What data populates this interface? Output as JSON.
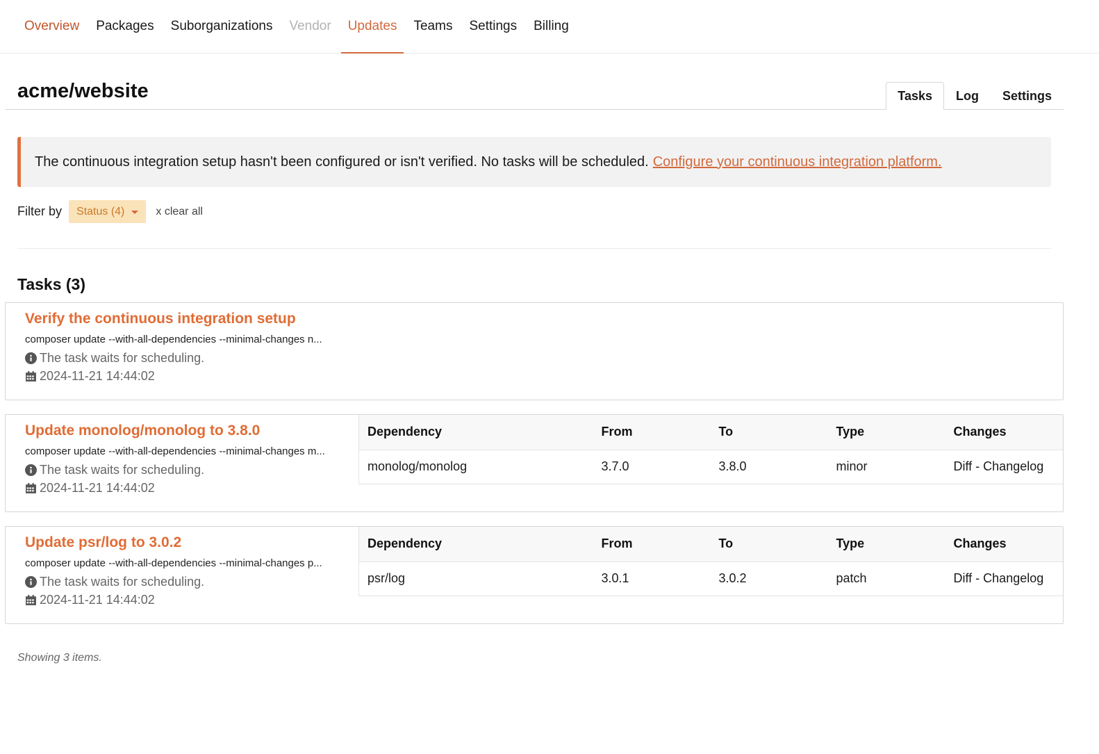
{
  "nav": {
    "items": [
      {
        "label": "Overview"
      },
      {
        "label": "Packages"
      },
      {
        "label": "Suborganizations"
      },
      {
        "label": "Vendor"
      },
      {
        "label": "Updates"
      },
      {
        "label": "Teams"
      },
      {
        "label": "Settings"
      },
      {
        "label": "Billing"
      }
    ],
    "active": "Updates"
  },
  "header": {
    "title": "acme/website",
    "tabs": [
      {
        "label": "Tasks"
      },
      {
        "label": "Log"
      },
      {
        "label": "Settings"
      }
    ],
    "active_tab": "Tasks"
  },
  "alert": {
    "text": "The continuous integration setup hasn't been configured or isn't verified. No tasks will be scheduled.",
    "link": "Configure your continuous integration platform."
  },
  "filter": {
    "label": "Filter by",
    "status_button": "Status (4)",
    "clear_all": "x clear all"
  },
  "tasks_heading": "Tasks (3)",
  "table_headers": {
    "dependency": "Dependency",
    "from": "From",
    "to": "To",
    "type": "Type",
    "changes": "Changes"
  },
  "tasks": [
    {
      "title": "Verify the continuous integration setup",
      "command": "composer update --with-all-dependencies --minimal-changes n...",
      "status": "The task waits for scheduling.",
      "date": "2024-11-21 14:44:02"
    },
    {
      "title": "Update monolog/monolog to 3.8.0",
      "command": "composer update --with-all-dependencies --minimal-changes m...",
      "status": "The task waits for scheduling.",
      "date": "2024-11-21 14:44:02",
      "dependency": {
        "name": "monolog/monolog",
        "from": "3.7.0",
        "to": "3.8.0",
        "type": "minor",
        "changes": "Diff - Changelog"
      }
    },
    {
      "title": "Update psr/log to 3.0.2",
      "command": "composer update --with-all-dependencies --minimal-changes p...",
      "status": "The task waits for scheduling.",
      "date": "2024-11-21 14:44:02",
      "dependency": {
        "name": "psr/log",
        "from": "3.0.1",
        "to": "3.0.2",
        "type": "patch",
        "changes": "Diff - Changelog"
      }
    }
  ],
  "footer": {
    "showing": "Showing 3 items."
  },
  "colors": {
    "accent": "#d2693d",
    "alert_border": "#e2703f",
    "filter_bg": "#fbe3b9"
  },
  "icons": {
    "status": "info-circle-icon",
    "date": "calendar-icon"
  }
}
